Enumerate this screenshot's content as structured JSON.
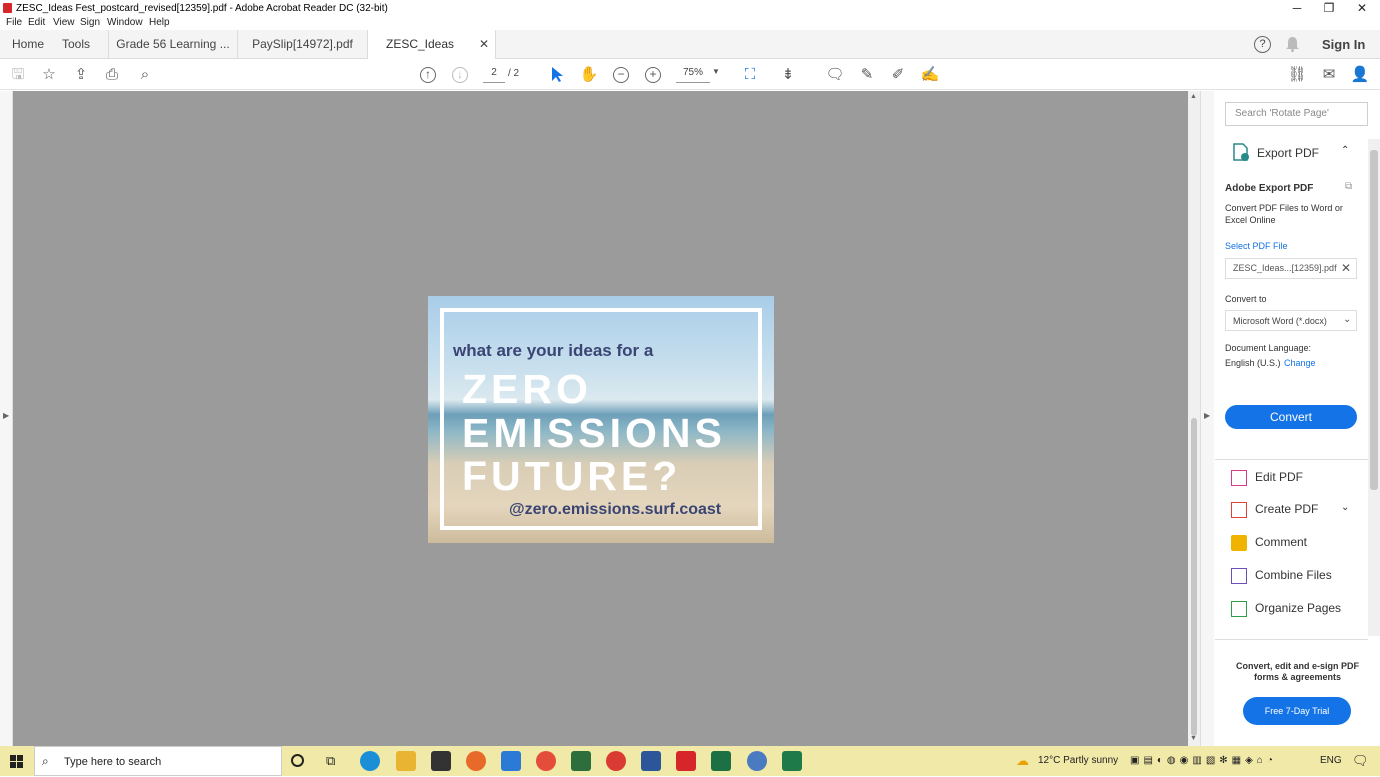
{
  "window": {
    "title": "ZESC_Ideas Fest_postcard_revised[12359].pdf - Adobe Acrobat Reader DC (32-bit)",
    "minimize": "─",
    "maximize": "❐",
    "close": "✕"
  },
  "menu": [
    "File",
    "Edit",
    "View",
    "Sign",
    "Window",
    "Help"
  ],
  "tabs": {
    "home": "Home",
    "tools": "Tools",
    "docs": [
      "Grade 56 Learning ...",
      "PaySlip[14972].pdf",
      "ZESC_Ideas Fest_po..."
    ],
    "close": "✕",
    "sign_in": "Sign In"
  },
  "toolbar": {
    "page_current": "2",
    "page_total": "/ 2",
    "zoom": "75%"
  },
  "postcard": {
    "question": "what are your ideas for a",
    "line1": "ZERO",
    "line2": "EMISSIONS",
    "line3": "FUTURE?",
    "handle": "@zero.emissions.surf.coast"
  },
  "right_panel": {
    "search_placeholder": "Search 'Rotate Page'",
    "export_header": "Export PDF",
    "export_title": "Adobe Export PDF",
    "export_desc": "Convert PDF Files to Word or Excel Online",
    "select_label": "Select PDF File",
    "selected_file": "ZESC_Ideas...[12359].pdf",
    "convert_to_label": "Convert to",
    "convert_to_value": "Microsoft Word (*.docx)",
    "doc_lang_label": "Document Language:",
    "doc_lang_value": "English (U.S.)",
    "change": "Change",
    "convert_button": "Convert",
    "tools": [
      "Edit PDF",
      "Create PDF",
      "Comment",
      "Combine Files",
      "Organize Pages"
    ],
    "promo": "Convert, edit and e-sign PDF forms & agreements",
    "trial_button": "Free 7-Day Trial"
  },
  "taskbar": {
    "search_placeholder": "Type here to search",
    "weather": "12°C  Partly sunny",
    "lang": "ENG"
  },
  "colors": {
    "accent": "#1473e6",
    "doc_bg": "#9b9b9b",
    "postcard_text": "#3a4574",
    "taskbar": "#f0e9a8"
  }
}
